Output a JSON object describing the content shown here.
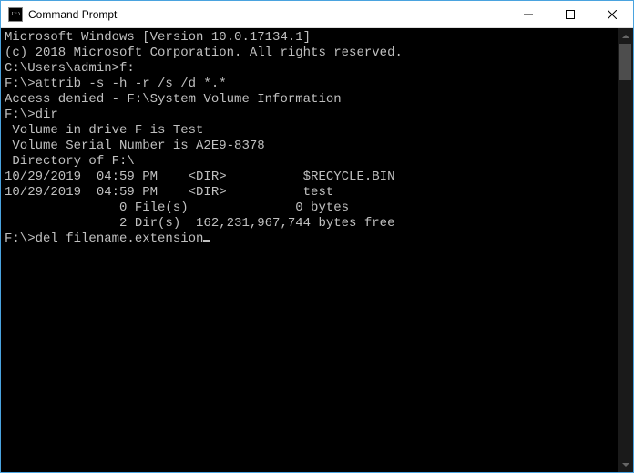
{
  "window": {
    "title": "Command Prompt",
    "icon_text": "C:\\"
  },
  "terminal": {
    "lines": [
      "Microsoft Windows [Version 10.0.17134.1]",
      "(c) 2018 Microsoft Corporation. All rights reserved.",
      "",
      "C:\\Users\\admin>f:",
      "",
      "F:\\>attrib -s -h -r /s /d *.*",
      "Access denied - F:\\System Volume Information",
      "",
      "F:\\>dir",
      " Volume in drive F is Test",
      " Volume Serial Number is A2E9-8378",
      "",
      " Directory of F:\\",
      "",
      "10/29/2019  04:59 PM    <DIR>          $RECYCLE.BIN",
      "10/29/2019  04:59 PM    <DIR>          test",
      "               0 File(s)              0 bytes",
      "               2 Dir(s)  162,231,967,744 bytes free",
      "",
      "F:\\>del filename.extension"
    ]
  }
}
